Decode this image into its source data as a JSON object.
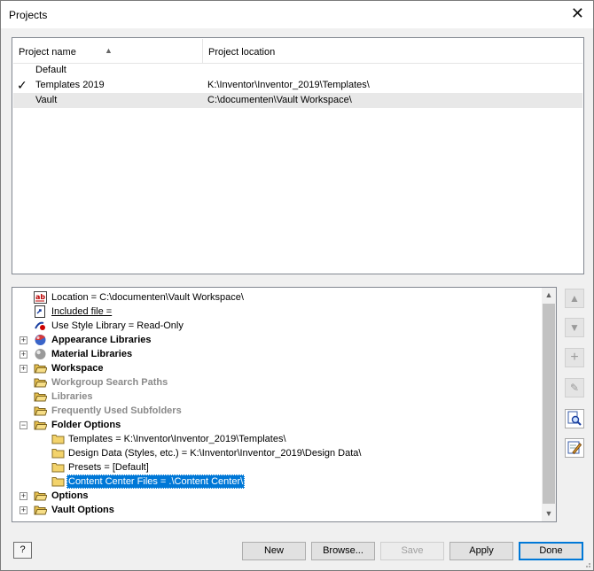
{
  "window": {
    "title": "Projects",
    "close_glyph": "✕"
  },
  "projects": {
    "columns": [
      "Project name",
      "Project location"
    ],
    "sort_glyph": "▲",
    "active_glyph": "✓",
    "rows": [
      {
        "name": "Default",
        "location": "",
        "active": false,
        "selected": false
      },
      {
        "name": "Templates 2019",
        "location": "K:\\Inventor\\Inventor_2019\\Templates\\",
        "active": true,
        "selected": false
      },
      {
        "name": "Vault",
        "location": "C:\\documenten\\Vault Workspace\\",
        "active": false,
        "selected": true
      }
    ]
  },
  "tree": {
    "expand_glyph": "+",
    "collapse_glyph": "−",
    "items": [
      {
        "label": "Location = C:\\documenten\\Vault Workspace\\",
        "icon": "text-field-icon",
        "style": "normal"
      },
      {
        "label": "Included file =",
        "icon": "document-link-icon",
        "style": "underline"
      },
      {
        "label": "Use Style Library = Read-Only",
        "icon": "style-library-icon",
        "style": "normal"
      },
      {
        "label": "Appearance Libraries",
        "icon": "appearance-sphere-icon",
        "style": "bold",
        "expander": "+"
      },
      {
        "label": "Material Libraries",
        "icon": "material-sphere-icon",
        "style": "bold",
        "expander": "+"
      },
      {
        "label": "Workspace",
        "icon": "folder-open-icon",
        "style": "bold",
        "expander": "+"
      },
      {
        "label": "Workgroup Search Paths",
        "icon": "folder-open-icon",
        "style": "gray"
      },
      {
        "label": "Libraries",
        "icon": "folder-open-icon",
        "style": "gray"
      },
      {
        "label": "Frequently Used Subfolders",
        "icon": "folder-open-icon",
        "style": "gray"
      },
      {
        "label": "Folder Options",
        "icon": "folder-open-icon",
        "style": "bold",
        "expander": "−"
      },
      {
        "label": "Templates = K:\\Inventor\\Inventor_2019\\Templates\\",
        "icon": "folder-icon",
        "style": "normal",
        "child": true
      },
      {
        "label": "Design Data (Styles, etc.) = K:\\Inventor\\Inventor_2019\\Design Data\\",
        "icon": "folder-icon",
        "style": "normal",
        "child": true
      },
      {
        "label": "Presets = [Default]",
        "icon": "folder-icon",
        "style": "normal",
        "child": true
      },
      {
        "label": "Content Center Files = .\\Content Center\\",
        "icon": "folder-icon",
        "style": "selected",
        "child": true
      },
      {
        "label": "Options",
        "icon": "folder-open-icon",
        "style": "bold",
        "expander": "+"
      },
      {
        "label": "Vault Options",
        "icon": "folder-open-icon",
        "style": "bold",
        "expander": "+"
      }
    ]
  },
  "scroll": {
    "up": "▲",
    "down": "▼"
  },
  "side_buttons": [
    {
      "name": "move-up-button",
      "glyph": "▲",
      "enabled": false
    },
    {
      "name": "move-down-button",
      "glyph": "▼",
      "enabled": false
    },
    {
      "name": "add-path-button",
      "glyph": "+",
      "enabled": false
    },
    {
      "name": "edit-button",
      "glyph": "✎",
      "enabled": false
    },
    {
      "name": "find-file-button",
      "glyph": "🔍",
      "enabled": true
    },
    {
      "name": "edit-project-file-button",
      "glyph": "✎",
      "enabled": true
    }
  ],
  "buttons": {
    "help": "?",
    "new": "New",
    "browse": "Browse...",
    "save": "Save",
    "apply": "Apply",
    "done": "Done"
  },
  "colors": {
    "selection": "#0078d7",
    "folder": "#f3d36b"
  }
}
